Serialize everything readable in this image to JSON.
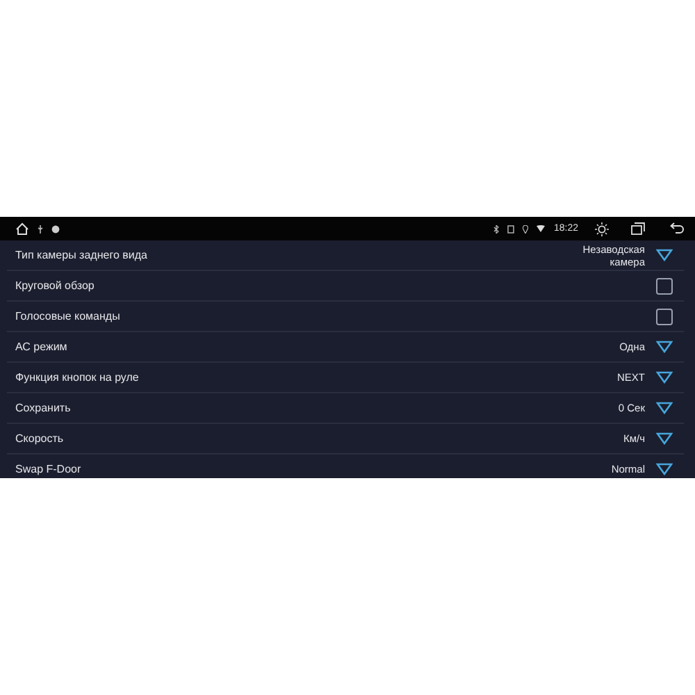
{
  "status_bar": {
    "time": "18:22"
  },
  "settings": [
    {
      "kind": "dropdown",
      "label": "Тип камеры заднего вида",
      "value": "Незаводская камера"
    },
    {
      "kind": "checkbox",
      "label": "Круговой обзор",
      "checked": false
    },
    {
      "kind": "checkbox",
      "label": "Голосовые команды",
      "checked": false
    },
    {
      "kind": "dropdown",
      "label": "АС режим",
      "value": "Одна"
    },
    {
      "kind": "dropdown",
      "label": "Функция кнопок на руле",
      "value": "NEXT"
    },
    {
      "kind": "dropdown",
      "label": "Сохранить",
      "value": "0 Сек"
    },
    {
      "kind": "dropdown",
      "label": "Скорость",
      "value": "Км/ч"
    },
    {
      "kind": "dropdown",
      "label": "Swap F-Door",
      "value": "Normal"
    }
  ]
}
